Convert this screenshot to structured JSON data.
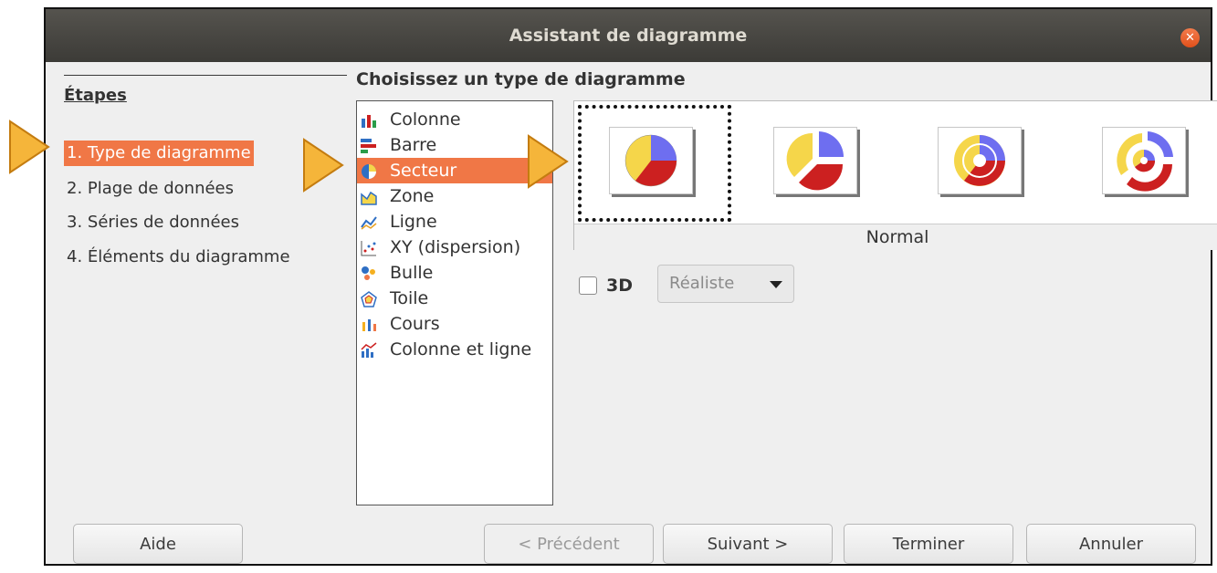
{
  "window": {
    "title": "Assistant de diagramme"
  },
  "steps": {
    "title": "Étapes",
    "items": [
      {
        "label": "1. Type de diagramme",
        "active": true
      },
      {
        "label": "2. Plage de données"
      },
      {
        "label": "3. Séries de données"
      },
      {
        "label": "4. Éléments du diagramme"
      }
    ]
  },
  "chart_type": {
    "heading": "Choisissez un type de diagramme",
    "types": [
      {
        "label": "Colonne",
        "icon": "column-chart-icon"
      },
      {
        "label": "Barre",
        "icon": "bar-chart-icon"
      },
      {
        "label": "Secteur",
        "icon": "pie-chart-icon",
        "selected": true
      },
      {
        "label": "Zone",
        "icon": "area-chart-icon"
      },
      {
        "label": "Ligne",
        "icon": "line-chart-icon"
      },
      {
        "label": "XY (dispersion)",
        "icon": "scatter-chart-icon"
      },
      {
        "label": "Bulle",
        "icon": "bubble-chart-icon"
      },
      {
        "label": "Toile",
        "icon": "net-chart-icon"
      },
      {
        "label": "Cours",
        "icon": "stock-chart-icon"
      },
      {
        "label": "Colonne et ligne",
        "icon": "column-line-chart-icon"
      }
    ],
    "variants": [
      {
        "icon": "pie-normal-icon",
        "selected": true
      },
      {
        "icon": "pie-exploded-icon"
      },
      {
        "icon": "donut-icon"
      },
      {
        "icon": "donut-exploded-icon"
      }
    ],
    "variant_label": "Normal",
    "option_3d": {
      "label": "3D",
      "checked": false
    },
    "style_select": {
      "value": "Réaliste",
      "enabled": false
    }
  },
  "buttons": {
    "help": "Aide",
    "previous": "< Précédent",
    "next": "Suivant >",
    "finish": "Terminer",
    "cancel": "Annuler"
  },
  "colors": {
    "accent": "#f07746",
    "titlebar": "#3c3b37",
    "pie_yellow": "#f5d64a",
    "pie_blue": "#6e6ef0",
    "pie_red": "#cc2020"
  }
}
